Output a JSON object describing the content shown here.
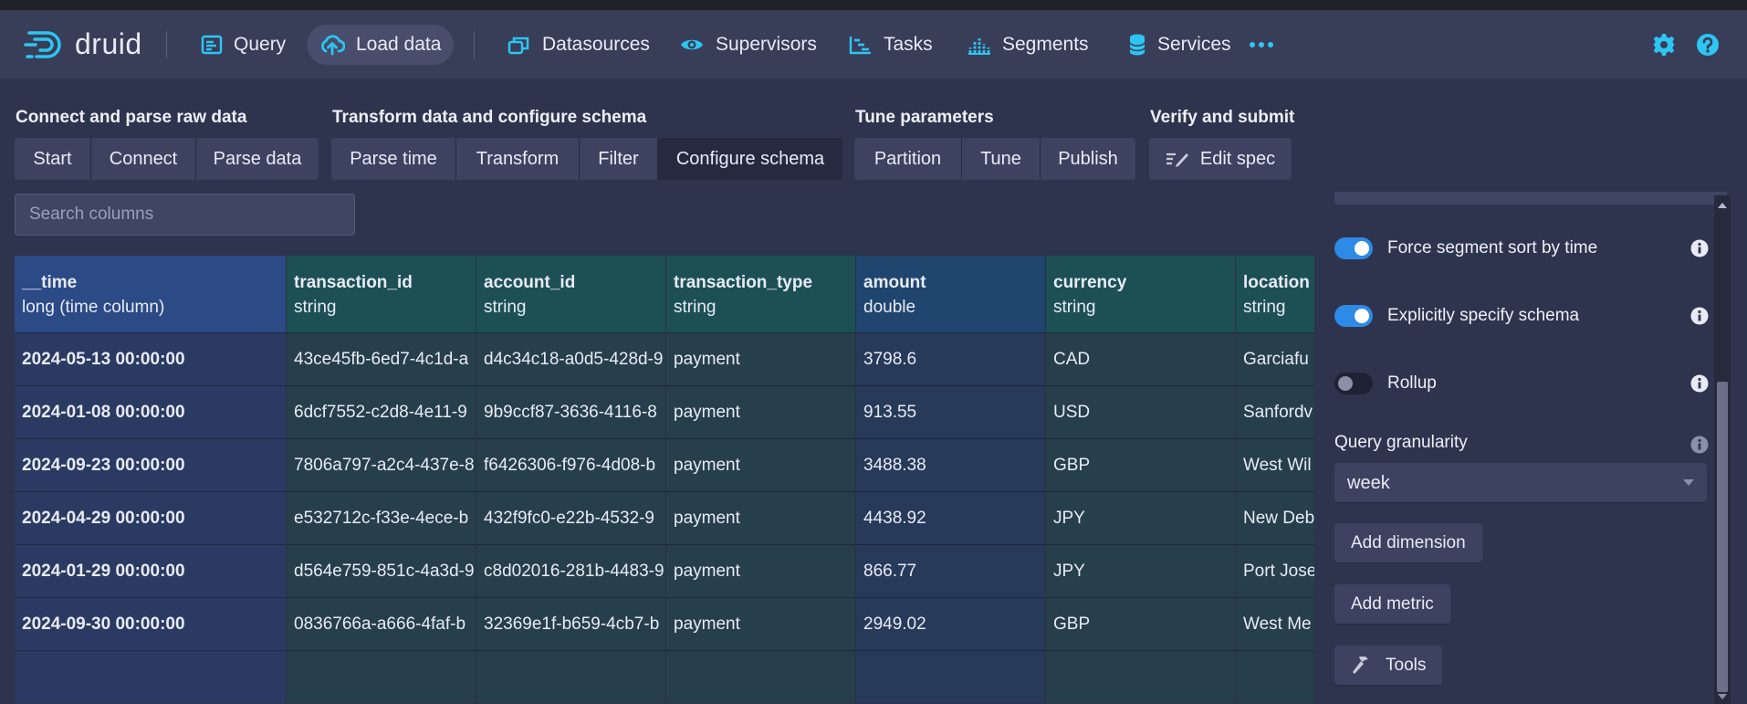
{
  "app": {
    "logo_text": "druid",
    "accent_color": "#2ec5f2"
  },
  "nav": {
    "query": "Query",
    "load_data": "Load data",
    "datasources": "Datasources",
    "supervisors": "Supervisors",
    "tasks": "Tasks",
    "segments": "Segments",
    "services": "Services",
    "more_icon": "more-icon",
    "settings_icon": "gear-icon",
    "help_icon": "help-icon"
  },
  "stages": {
    "connect": {
      "title": "Connect and parse raw data",
      "steps": [
        "Start",
        "Connect",
        "Parse data"
      ]
    },
    "transform": {
      "title": "Transform data and configure schema",
      "steps": [
        "Parse time",
        "Transform",
        "Filter",
        "Configure schema"
      ]
    },
    "tune": {
      "title": "Tune parameters",
      "steps": [
        "Partition",
        "Tune",
        "Publish"
      ]
    },
    "verify": {
      "title": "Verify and submit",
      "steps": [
        "Edit spec"
      ]
    },
    "active_step": "Configure schema"
  },
  "search": {
    "placeholder": "Search columns"
  },
  "table": {
    "columns": [
      {
        "name": "__time",
        "type": "long (time column)"
      },
      {
        "name": "transaction_id",
        "type": "string"
      },
      {
        "name": "account_id",
        "type": "string"
      },
      {
        "name": "transaction_type",
        "type": "string"
      },
      {
        "name": "amount",
        "type": "double"
      },
      {
        "name": "currency",
        "type": "string"
      },
      {
        "name": "location",
        "type": "string"
      }
    ],
    "rows": [
      [
        "2024-05-13 00:00:00",
        "43ce45fb-6ed7-4c1d-a",
        "d4c34c18-a0d5-428d-9",
        "payment",
        "3798.6",
        "CAD",
        "Garciafu"
      ],
      [
        "2024-01-08 00:00:00",
        "6dcf7552-c2d8-4e11-9",
        "9b9ccf87-3636-4116-8",
        "payment",
        "913.55",
        "USD",
        "Sanfordv"
      ],
      [
        "2024-09-23 00:00:00",
        "7806a797-a2c4-437e-8",
        "f6426306-f976-4d08-b",
        "payment",
        "3488.38",
        "GBP",
        "West Wil"
      ],
      [
        "2024-04-29 00:00:00",
        "e532712c-f33e-4ece-b",
        "432f9fc0-e22b-4532-9",
        "payment",
        "4438.92",
        "JPY",
        "New Deb"
      ],
      [
        "2024-01-29 00:00:00",
        "d564e759-851c-4a3d-9",
        "c8d02016-281b-4483-9",
        "payment",
        "866.77",
        "JPY",
        "Port Jose"
      ],
      [
        "2024-09-30 00:00:00",
        "0836766a-a666-4faf-b",
        "32369e1f-b659-4cb7-b",
        "payment",
        "2949.02",
        "GBP",
        "West Me"
      ]
    ]
  },
  "panel": {
    "force_sort": {
      "label": "Force segment sort by time",
      "on": true
    },
    "explicit_schema": {
      "label": "Explicitly specify schema",
      "on": true
    },
    "rollup": {
      "label": "Rollup",
      "on": false
    },
    "query_granularity": {
      "label": "Query granularity",
      "value": "week"
    },
    "add_dimension": "Add dimension",
    "add_metric": "Add metric",
    "tools": "Tools"
  }
}
